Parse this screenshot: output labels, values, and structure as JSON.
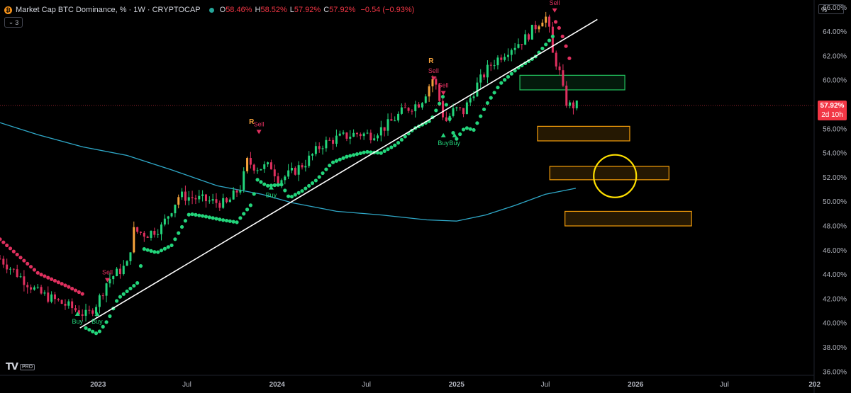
{
  "header": {
    "title": "Market Cap BTC Dominance, %",
    "interval": "1W",
    "source": "CRYPTOCAP",
    "symbol_icon": "₿",
    "open_key": "O",
    "open": "58.46%",
    "high_key": "H",
    "high": "58.52%",
    "low_key": "L",
    "low": "57.92%",
    "close_key": "C",
    "close": "57.92%",
    "change": "−0.54 (−0.93%)",
    "indicator_count": "3"
  },
  "price_scale": {
    "unit_button": "%"
  },
  "last_price": {
    "value": "57.92%",
    "countdown": "2d 10h",
    "color": "#f23645"
  },
  "logo": {
    "text": "TV",
    "badge": "PRO"
  },
  "colors": {
    "background": "#000000",
    "up": "#23d57b",
    "down": "#e0305f",
    "warm": "#f5a23b",
    "ema": "#2fa9c9",
    "trendline": "#ffffff",
    "green_zone": "#22c55e",
    "orange_zone": "#f59e0b",
    "circle": "#ffe000",
    "grid_text": "#b2b5be"
  },
  "chart_data": {
    "type": "candlestick",
    "title": "Market Cap BTC Dominance, %",
    "x_axis": {
      "range": [
        "2022-06-15",
        "2026-12-31"
      ],
      "ticks": [
        {
          "date": "2023-01-01",
          "label": "2023",
          "bold": true
        },
        {
          "date": "2023-07-01",
          "label": "Jul",
          "bold": false
        },
        {
          "date": "2024-01-01",
          "label": "2024",
          "bold": true
        },
        {
          "date": "2024-07-01",
          "label": "Jul",
          "bold": false
        },
        {
          "date": "2025-01-01",
          "label": "2025",
          "bold": true
        },
        {
          "date": "2025-07-01",
          "label": "Jul",
          "bold": false
        },
        {
          "date": "2026-01-01",
          "label": "2026",
          "bold": true
        },
        {
          "date": "2026-07-01",
          "label": "Jul",
          "bold": false
        },
        {
          "date": "2027-01-01",
          "label": "202",
          "bold": true
        }
      ]
    },
    "y_axis": {
      "range": [
        35.7,
        66.6
      ],
      "ticks": [
        36,
        38,
        40,
        42,
        44,
        46,
        48,
        50,
        52,
        54,
        56,
        58,
        60,
        62,
        64,
        66
      ],
      "format": "%"
    },
    "grid": false,
    "price_anchors": [
      [
        "2022-06-15",
        45.3
      ],
      [
        "2022-09-01",
        42.5
      ],
      [
        "2022-11-01",
        41.4
      ],
      [
        "2022-12-10",
        40.6
      ],
      [
        "2023-01-01",
        41.8
      ],
      [
        "2023-01-20",
        43.5
      ],
      [
        "2023-03-01",
        44.8
      ],
      [
        "2023-03-15",
        47.6
      ],
      [
        "2023-04-10",
        47.3
      ],
      [
        "2023-05-10",
        47.9
      ],
      [
        "2023-06-15",
        50.5
      ],
      [
        "2023-07-15",
        50.3
      ],
      [
        "2023-08-20",
        50.0
      ],
      [
        "2023-09-20",
        49.8
      ],
      [
        "2023-10-20",
        51.3
      ],
      [
        "2023-11-01",
        53.3
      ],
      [
        "2023-11-20",
        52.8
      ],
      [
        "2023-12-20",
        52.9
      ],
      [
        "2024-01-05",
        51.8
      ],
      [
        "2024-02-01",
        52.4
      ],
      [
        "2024-03-01",
        53.3
      ],
      [
        "2024-04-01",
        54.7
      ],
      [
        "2024-05-01",
        55.2
      ],
      [
        "2024-06-10",
        55.6
      ],
      [
        "2024-07-10",
        55.5
      ],
      [
        "2024-08-10",
        56.2
      ],
      [
        "2024-09-15",
        57.5
      ],
      [
        "2024-10-20",
        58.2
      ],
      [
        "2024-11-15",
        60.3
      ],
      [
        "2024-12-08",
        56.5
      ],
      [
        "2024-12-28",
        57.6
      ],
      [
        "2025-01-15",
        57.4
      ],
      [
        "2025-02-10",
        59.5
      ],
      [
        "2025-03-10",
        61.2
      ],
      [
        "2025-04-15",
        62.5
      ],
      [
        "2025-05-20",
        63.4
      ],
      [
        "2025-06-25",
        65.1
      ],
      [
        "2025-07-05",
        65.2
      ],
      [
        "2025-07-15",
        62.2
      ],
      [
        "2025-07-28",
        61.0
      ],
      [
        "2025-08-10",
        58.3
      ],
      [
        "2025-08-20",
        57.9
      ],
      [
        "2025-09-03",
        57.92
      ]
    ],
    "trend_dots_last": [
      "2025-07-20",
      63.0
    ],
    "trend_dots_down": [
      [
        "2025-07-22",
        64.8
      ],
      [
        "2025-07-29",
        64.3
      ],
      [
        "2025-08-05",
        63.6
      ],
      [
        "2025-08-12",
        62.8
      ],
      [
        "2025-08-19",
        61.8
      ]
    ],
    "ema_line": [
      [
        "2022-06-15",
        56.5
      ],
      [
        "2022-09-01",
        55.5
      ],
      [
        "2022-12-01",
        54.5
      ],
      [
        "2023-03-01",
        53.8
      ],
      [
        "2023-06-01",
        52.6
      ],
      [
        "2023-09-01",
        51.3
      ],
      [
        "2023-12-01",
        50.6
      ],
      [
        "2024-02-01",
        49.9
      ],
      [
        "2024-05-01",
        49.2
      ],
      [
        "2024-08-01",
        48.9
      ],
      [
        "2024-11-01",
        48.5
      ],
      [
        "2025-01-01",
        48.4
      ],
      [
        "2025-03-01",
        48.9
      ],
      [
        "2025-05-01",
        49.7
      ],
      [
        "2025-07-01",
        50.6
      ],
      [
        "2025-09-01",
        51.1
      ]
    ],
    "trendline": {
      "from": [
        "2022-11-25",
        39.6
      ],
      "to": [
        "2025-10-15",
        65.0
      ]
    },
    "zones": [
      {
        "type": "green",
        "from": "2025-05-10",
        "to": "2025-12-10",
        "top": 60.4,
        "bottom": 59.2
      },
      {
        "type": "orange",
        "from": "2025-06-15",
        "to": "2025-12-20",
        "top": 56.2,
        "bottom": 55.0
      },
      {
        "type": "orange",
        "from": "2025-07-10",
        "to": "2026-03-10",
        "top": 52.9,
        "bottom": 51.8
      },
      {
        "type": "orange",
        "from": "2025-08-10",
        "to": "2026-04-25",
        "top": 49.2,
        "bottom": 48.0
      }
    ],
    "circle": {
      "center": [
        "2025-11-20",
        52.1
      ],
      "radius_weeks": 6.2
    },
    "current_price": 57.92,
    "signals": [
      {
        "type": "Buy",
        "date": "2022-11-20",
        "value": 40.6
      },
      {
        "type": "Buy",
        "date": "2022-12-30",
        "value": 40.6
      },
      {
        "type": "Sell",
        "date": "2023-01-20",
        "value": 44.0
      },
      {
        "type": "Sell",
        "date": "2023-11-25",
        "value": 56.2
      },
      {
        "type": "Buy",
        "date": "2023-12-20",
        "value": 51.0
      },
      {
        "type": "Sell",
        "date": "2024-11-15",
        "value": 60.6
      },
      {
        "type": "Buy",
        "date": "2024-12-05",
        "value": 55.3
      },
      {
        "type": "Sell",
        "date": "2024-12-05",
        "value": 59.4
      },
      {
        "type": "Buy",
        "date": "2024-12-28",
        "value": 55.3
      },
      {
        "type": "Sell",
        "date": "2025-07-20",
        "value": 66.2
      }
    ],
    "markers": [
      {
        "label": "R",
        "date": "2023-11-10",
        "value": 56.4
      },
      {
        "label": "R",
        "date": "2024-11-10",
        "value": 61.4
      }
    ]
  }
}
